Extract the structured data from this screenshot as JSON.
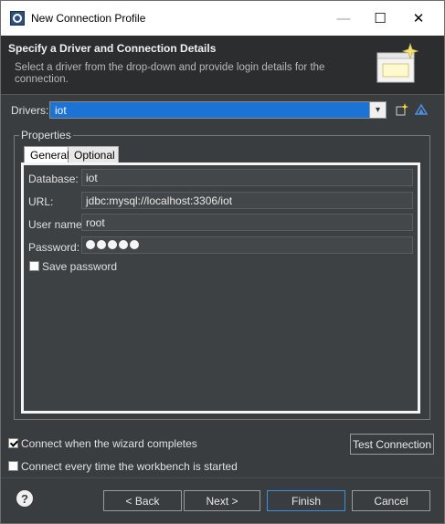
{
  "window": {
    "title": "New Connection Profile",
    "min_glyph": "—",
    "max_glyph": "☐",
    "close_glyph": "✕"
  },
  "header": {
    "title": "Specify a Driver and Connection Details",
    "description": "Select a driver from the drop-down and provide login details for the connection."
  },
  "drivers": {
    "label": "Drivers:",
    "value": "iot",
    "arrow": "▾"
  },
  "properties": {
    "group_label": "Properties",
    "tabs": [
      {
        "label": "General"
      },
      {
        "label": "Optional"
      }
    ],
    "fields": {
      "database": {
        "label": "Database:",
        "value": "iot"
      },
      "url": {
        "label": "URL:",
        "value": "jdbc:mysql://localhost:3306/iot"
      },
      "username": {
        "label": "User name:",
        "value": "root"
      },
      "password": {
        "label": "Password:",
        "masked_length": 5
      }
    },
    "save_password": {
      "label": "Save password",
      "checked": false
    }
  },
  "options": {
    "connect_on_finish": {
      "label": "Connect when the wizard completes",
      "checked": true
    },
    "connect_on_startup": {
      "label": "Connect every time the workbench is started",
      "checked": false
    }
  },
  "buttons": {
    "test_connection": "Test Connection",
    "back": "< Back",
    "next": "Next >",
    "finish": "Finish",
    "cancel": "Cancel",
    "help": "?"
  },
  "colors": {
    "accent": "#1b73d6",
    "background": "#3a3d40",
    "header_bg": "#2b2d2f"
  },
  "icons": [
    "app-icon",
    "new-driver-icon",
    "edit-driver-icon",
    "banner-icon",
    "help-icon"
  ]
}
